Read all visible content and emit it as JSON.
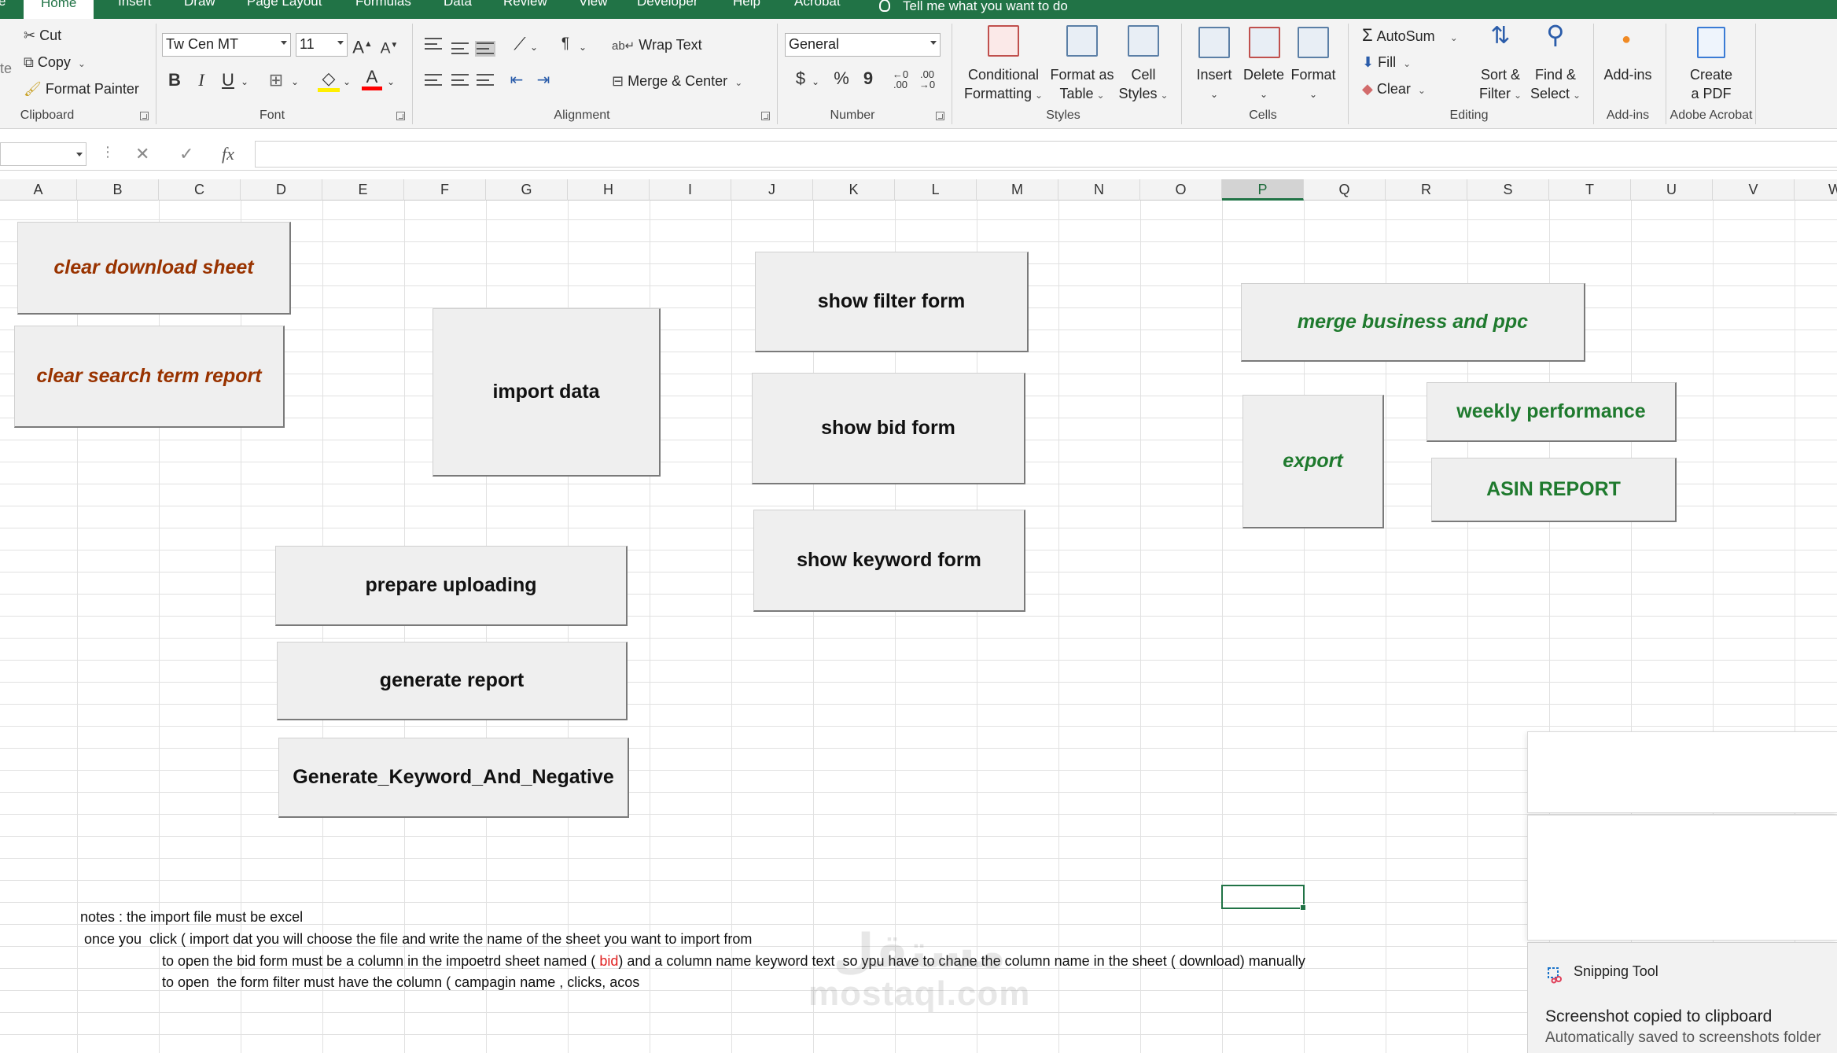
{
  "ribbon_tabs": [
    "Home",
    "Insert",
    "Draw",
    "Page Layout",
    "Formulas",
    "Data",
    "Review",
    "View",
    "Developer",
    "Help",
    "Acrobat"
  ],
  "tell_me": "Tell me what you want to do",
  "clipboard": {
    "cut": "Cut",
    "copy": "Copy",
    "format_painter": "Format Painter",
    "paste_partial": "te",
    "group": "Clipboard"
  },
  "font": {
    "name": "Tw Cen MT",
    "size": "11",
    "group": "Font",
    "bold": "B",
    "italic": "I",
    "underline": "U"
  },
  "alignment": {
    "wrap_text": "Wrap Text",
    "merge_center": "Merge & Center",
    "group": "Alignment"
  },
  "number": {
    "format": "General",
    "currency": "$",
    "percent": "%",
    "comma": "9",
    "group": "Number"
  },
  "styles": {
    "conditional": [
      "Conditional",
      "Formatting"
    ],
    "format_table": [
      "Format as",
      "Table"
    ],
    "cell_styles": [
      "Cell",
      "Styles"
    ],
    "group": "Styles"
  },
  "cells_group": {
    "insert": "Insert",
    "delete": "Delete",
    "format": "Format",
    "group": "Cells"
  },
  "editing": {
    "autosum": "AutoSum",
    "fill": "Fill",
    "clear": "Clear",
    "sort_filter": [
      "Sort &",
      "Filter"
    ],
    "find_select": [
      "Find &",
      "Select"
    ],
    "group": "Editing"
  },
  "addins": {
    "label": "Add-ins",
    "group": "Add-ins"
  },
  "acrobat": {
    "create": [
      "Create",
      "a PDF"
    ],
    "group": "Adobe Acrobat"
  },
  "formula_bar": {
    "fx": "fx",
    "cancel": "✕",
    "confirm": "✓"
  },
  "columns": [
    "A",
    "B",
    "C",
    "D",
    "E",
    "F",
    "G",
    "H",
    "I",
    "J",
    "K",
    "L",
    "M",
    "N",
    "O",
    "P",
    "Q",
    "R",
    "S",
    "T",
    "U",
    "V",
    "W"
  ],
  "selected_column": "P",
  "buttons": {
    "clear_download": "clear download sheet",
    "clear_search": "clear search term report",
    "import_data": "import data",
    "show_filter": "show filter form",
    "show_bid": "show bid form",
    "show_keyword": "show keyword form",
    "prepare_uploading": "prepare uploading",
    "generate_report": "generate report",
    "generate_keyword": "Generate_Keyword_And_Negative",
    "merge_business": "merge business and ppc",
    "export": "export",
    "weekly_performance": "weekly performance",
    "asin_report": "ASIN REPORT"
  },
  "notes": {
    "line1": "notes :  the import file must be excel",
    "line2": " once you  click ( import dat you will choose the file and write the name of the sheet you want to import from",
    "line3_pre": "to open the bid form must be a column in the impoetrd sheet named ( ",
    "line3_red": "bid",
    "line3_post": ") and a column name keyword text  so ypu have to chane the column name in the sheet ( download) manually",
    "line4": "to open  the form filter must have the column ( campagin name , clicks, acos"
  },
  "watermark": {
    "arabic": "مستقل",
    "latin": "mostaql.com"
  },
  "toast": {
    "app": "Snipping Tool",
    "title": "Screenshot copied to clipboard",
    "body": "Automatically saved to screenshots folder"
  },
  "colors": {
    "excel_green": "#217346",
    "brown_label": "#993300",
    "green_label": "#1f7a2e",
    "note_red": "#e02020"
  }
}
